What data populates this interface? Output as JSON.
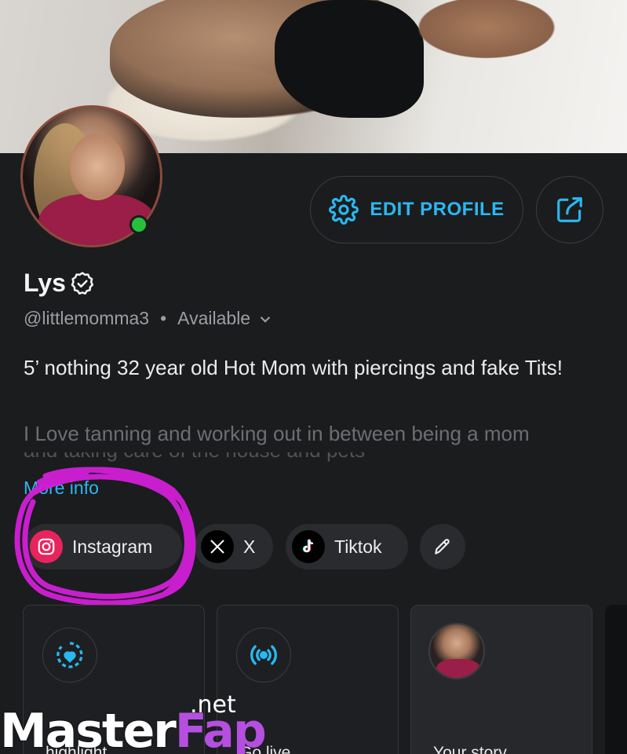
{
  "profile": {
    "name": "Lys",
    "handle": "@littlemomma3",
    "status": "Available",
    "bio_line1": "5’ nothing 32 year old Hot Mom with piercings and fake Tits!",
    "bio_line2": "I Love tanning and working out in between being a mom",
    "bio_line3": "and taking care of the house and pets",
    "more_info": "More info"
  },
  "actions": {
    "edit_profile": "EDIT PROFILE"
  },
  "socials": [
    {
      "label": "Instagram"
    },
    {
      "label": "X"
    },
    {
      "label": "Tiktok"
    }
  ],
  "cards": [
    {
      "label": "New highlight",
      "line2": "highlight"
    },
    {
      "label": "Go live"
    },
    {
      "label": "Your story"
    }
  ],
  "watermark": {
    "part1": "Master",
    "part2": "Fap",
    "suffix": ".net"
  },
  "colors": {
    "accent": "#2ab8f0",
    "background": "#1b1c1e",
    "online": "#27c03c",
    "scribble": "#d21fd8"
  }
}
